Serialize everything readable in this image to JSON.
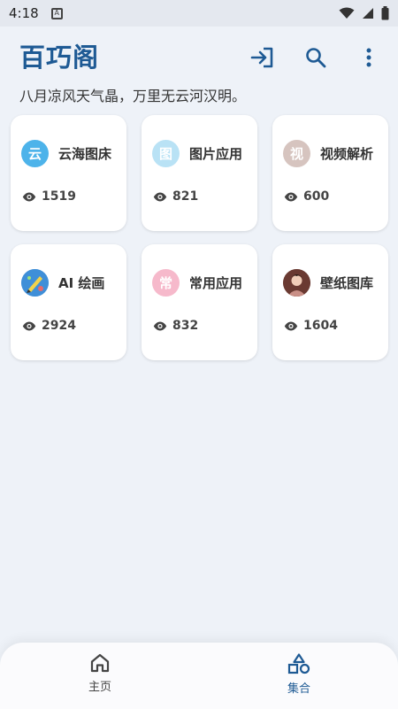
{
  "status_bar": {
    "time": "4:18",
    "notification_glyph": "A"
  },
  "app": {
    "title": "百巧阁",
    "subtitle": "八月凉风天气晶，万里无云河汉明。"
  },
  "actions": {
    "login_icon": "login-icon",
    "search_icon": "search-icon",
    "more_icon": "more-vert-icon"
  },
  "cards": [
    {
      "name": "云海图床",
      "views": "1519",
      "icon_text": "云",
      "icon_color": "#4db3ea"
    },
    {
      "name": "图片应用",
      "views": "821",
      "icon_text": "图",
      "icon_color": "#b9e2f5"
    },
    {
      "name": "视频解析",
      "views": "600",
      "icon_text": "视",
      "icon_color": "#d6c4bf"
    },
    {
      "name": "AI 绘画",
      "views": "2924",
      "icon_text": "",
      "icon_color": "#3f8fd8"
    },
    {
      "name": "常用应用",
      "views": "832",
      "icon_text": "常",
      "icon_color": "#f6b9cb"
    },
    {
      "name": "壁纸图库",
      "views": "1604",
      "icon_text": "",
      "icon_color": "#6a3a32"
    }
  ],
  "bottom_nav": [
    {
      "label": "主页",
      "icon": "home-icon",
      "active": false
    },
    {
      "label": "集合",
      "icon": "shapes-icon",
      "active": true
    }
  ],
  "colors": {
    "primary": "#1e5a94",
    "background": "#eef2f8"
  }
}
